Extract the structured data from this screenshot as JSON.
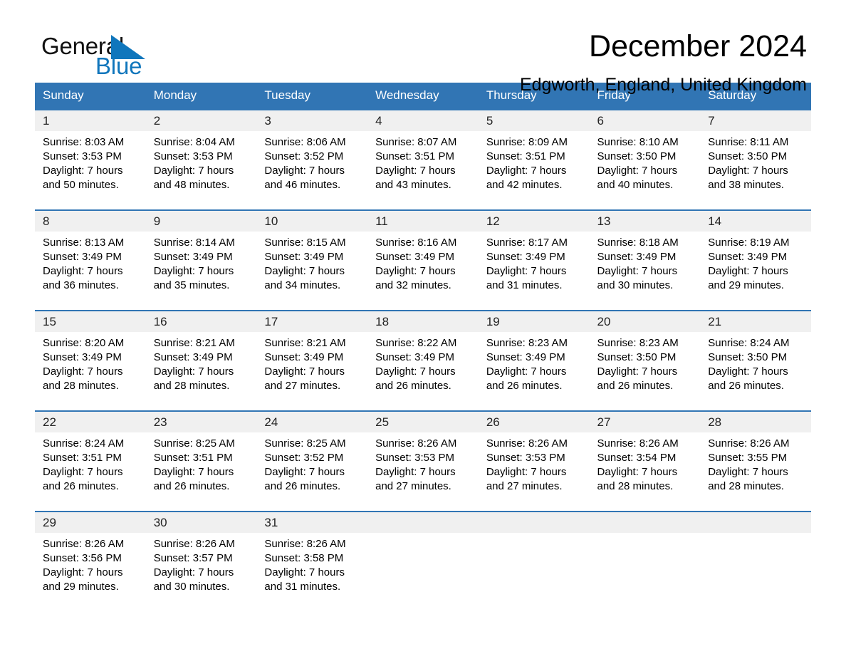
{
  "brand": {
    "name_part1": "General",
    "name_part2": "Blue",
    "accent_color": "#1076bc",
    "triangle_icon": "triangle-right-icon"
  },
  "header": {
    "title": "December 2024",
    "subtitle": "Edgworth, England, United Kingdom"
  },
  "calendar": {
    "header_bg": "#3175b4",
    "daynum_bg": "#f0f0f0",
    "weekdays": [
      "Sunday",
      "Monday",
      "Tuesday",
      "Wednesday",
      "Thursday",
      "Friday",
      "Saturday"
    ],
    "weeks": [
      [
        {
          "day": "1",
          "sunrise": "Sunrise: 8:03 AM",
          "sunset": "Sunset: 3:53 PM",
          "daylight_line1": "Daylight: 7 hours",
          "daylight_line2": "and 50 minutes."
        },
        {
          "day": "2",
          "sunrise": "Sunrise: 8:04 AM",
          "sunset": "Sunset: 3:53 PM",
          "daylight_line1": "Daylight: 7 hours",
          "daylight_line2": "and 48 minutes."
        },
        {
          "day": "3",
          "sunrise": "Sunrise: 8:06 AM",
          "sunset": "Sunset: 3:52 PM",
          "daylight_line1": "Daylight: 7 hours",
          "daylight_line2": "and 46 minutes."
        },
        {
          "day": "4",
          "sunrise": "Sunrise: 8:07 AM",
          "sunset": "Sunset: 3:51 PM",
          "daylight_line1": "Daylight: 7 hours",
          "daylight_line2": "and 43 minutes."
        },
        {
          "day": "5",
          "sunrise": "Sunrise: 8:09 AM",
          "sunset": "Sunset: 3:51 PM",
          "daylight_line1": "Daylight: 7 hours",
          "daylight_line2": "and 42 minutes."
        },
        {
          "day": "6",
          "sunrise": "Sunrise: 8:10 AM",
          "sunset": "Sunset: 3:50 PM",
          "daylight_line1": "Daylight: 7 hours",
          "daylight_line2": "and 40 minutes."
        },
        {
          "day": "7",
          "sunrise": "Sunrise: 8:11 AM",
          "sunset": "Sunset: 3:50 PM",
          "daylight_line1": "Daylight: 7 hours",
          "daylight_line2": "and 38 minutes."
        }
      ],
      [
        {
          "day": "8",
          "sunrise": "Sunrise: 8:13 AM",
          "sunset": "Sunset: 3:49 PM",
          "daylight_line1": "Daylight: 7 hours",
          "daylight_line2": "and 36 minutes."
        },
        {
          "day": "9",
          "sunrise": "Sunrise: 8:14 AM",
          "sunset": "Sunset: 3:49 PM",
          "daylight_line1": "Daylight: 7 hours",
          "daylight_line2": "and 35 minutes."
        },
        {
          "day": "10",
          "sunrise": "Sunrise: 8:15 AM",
          "sunset": "Sunset: 3:49 PM",
          "daylight_line1": "Daylight: 7 hours",
          "daylight_line2": "and 34 minutes."
        },
        {
          "day": "11",
          "sunrise": "Sunrise: 8:16 AM",
          "sunset": "Sunset: 3:49 PM",
          "daylight_line1": "Daylight: 7 hours",
          "daylight_line2": "and 32 minutes."
        },
        {
          "day": "12",
          "sunrise": "Sunrise: 8:17 AM",
          "sunset": "Sunset: 3:49 PM",
          "daylight_line1": "Daylight: 7 hours",
          "daylight_line2": "and 31 minutes."
        },
        {
          "day": "13",
          "sunrise": "Sunrise: 8:18 AM",
          "sunset": "Sunset: 3:49 PM",
          "daylight_line1": "Daylight: 7 hours",
          "daylight_line2": "and 30 minutes."
        },
        {
          "day": "14",
          "sunrise": "Sunrise: 8:19 AM",
          "sunset": "Sunset: 3:49 PM",
          "daylight_line1": "Daylight: 7 hours",
          "daylight_line2": "and 29 minutes."
        }
      ],
      [
        {
          "day": "15",
          "sunrise": "Sunrise: 8:20 AM",
          "sunset": "Sunset: 3:49 PM",
          "daylight_line1": "Daylight: 7 hours",
          "daylight_line2": "and 28 minutes."
        },
        {
          "day": "16",
          "sunrise": "Sunrise: 8:21 AM",
          "sunset": "Sunset: 3:49 PM",
          "daylight_line1": "Daylight: 7 hours",
          "daylight_line2": "and 28 minutes."
        },
        {
          "day": "17",
          "sunrise": "Sunrise: 8:21 AM",
          "sunset": "Sunset: 3:49 PM",
          "daylight_line1": "Daylight: 7 hours",
          "daylight_line2": "and 27 minutes."
        },
        {
          "day": "18",
          "sunrise": "Sunrise: 8:22 AM",
          "sunset": "Sunset: 3:49 PM",
          "daylight_line1": "Daylight: 7 hours",
          "daylight_line2": "and 26 minutes."
        },
        {
          "day": "19",
          "sunrise": "Sunrise: 8:23 AM",
          "sunset": "Sunset: 3:49 PM",
          "daylight_line1": "Daylight: 7 hours",
          "daylight_line2": "and 26 minutes."
        },
        {
          "day": "20",
          "sunrise": "Sunrise: 8:23 AM",
          "sunset": "Sunset: 3:50 PM",
          "daylight_line1": "Daylight: 7 hours",
          "daylight_line2": "and 26 minutes."
        },
        {
          "day": "21",
          "sunrise": "Sunrise: 8:24 AM",
          "sunset": "Sunset: 3:50 PM",
          "daylight_line1": "Daylight: 7 hours",
          "daylight_line2": "and 26 minutes."
        }
      ],
      [
        {
          "day": "22",
          "sunrise": "Sunrise: 8:24 AM",
          "sunset": "Sunset: 3:51 PM",
          "daylight_line1": "Daylight: 7 hours",
          "daylight_line2": "and 26 minutes."
        },
        {
          "day": "23",
          "sunrise": "Sunrise: 8:25 AM",
          "sunset": "Sunset: 3:51 PM",
          "daylight_line1": "Daylight: 7 hours",
          "daylight_line2": "and 26 minutes."
        },
        {
          "day": "24",
          "sunrise": "Sunrise: 8:25 AM",
          "sunset": "Sunset: 3:52 PM",
          "daylight_line1": "Daylight: 7 hours",
          "daylight_line2": "and 26 minutes."
        },
        {
          "day": "25",
          "sunrise": "Sunrise: 8:26 AM",
          "sunset": "Sunset: 3:53 PM",
          "daylight_line1": "Daylight: 7 hours",
          "daylight_line2": "and 27 minutes."
        },
        {
          "day": "26",
          "sunrise": "Sunrise: 8:26 AM",
          "sunset": "Sunset: 3:53 PM",
          "daylight_line1": "Daylight: 7 hours",
          "daylight_line2": "and 27 minutes."
        },
        {
          "day": "27",
          "sunrise": "Sunrise: 8:26 AM",
          "sunset": "Sunset: 3:54 PM",
          "daylight_line1": "Daylight: 7 hours",
          "daylight_line2": "and 28 minutes."
        },
        {
          "day": "28",
          "sunrise": "Sunrise: 8:26 AM",
          "sunset": "Sunset: 3:55 PM",
          "daylight_line1": "Daylight: 7 hours",
          "daylight_line2": "and 28 minutes."
        }
      ],
      [
        {
          "day": "29",
          "sunrise": "Sunrise: 8:26 AM",
          "sunset": "Sunset: 3:56 PM",
          "daylight_line1": "Daylight: 7 hours",
          "daylight_line2": "and 29 minutes."
        },
        {
          "day": "30",
          "sunrise": "Sunrise: 8:26 AM",
          "sunset": "Sunset: 3:57 PM",
          "daylight_line1": "Daylight: 7 hours",
          "daylight_line2": "and 30 minutes."
        },
        {
          "day": "31",
          "sunrise": "Sunrise: 8:26 AM",
          "sunset": "Sunset: 3:58 PM",
          "daylight_line1": "Daylight: 7 hours",
          "daylight_line2": "and 31 minutes."
        },
        {
          "day": "",
          "sunrise": "",
          "sunset": "",
          "daylight_line1": "",
          "daylight_line2": ""
        },
        {
          "day": "",
          "sunrise": "",
          "sunset": "",
          "daylight_line1": "",
          "daylight_line2": ""
        },
        {
          "day": "",
          "sunrise": "",
          "sunset": "",
          "daylight_line1": "",
          "daylight_line2": ""
        },
        {
          "day": "",
          "sunrise": "",
          "sunset": "",
          "daylight_line1": "",
          "daylight_line2": ""
        }
      ]
    ]
  }
}
